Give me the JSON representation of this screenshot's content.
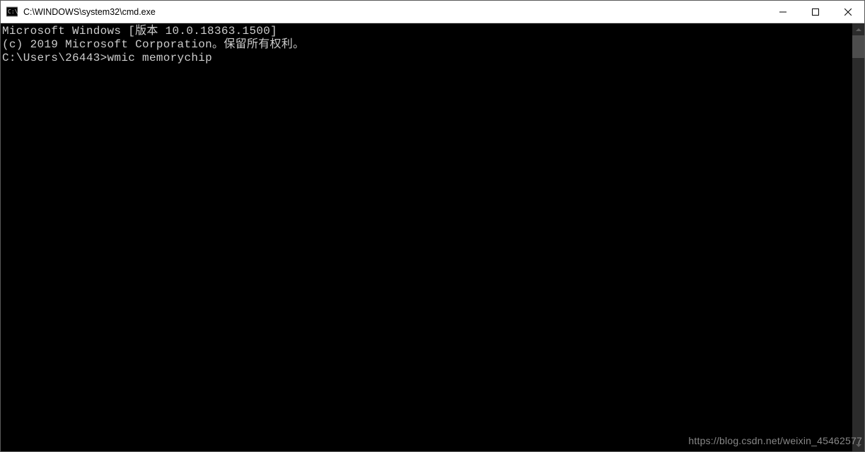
{
  "titlebar": {
    "title": "C:\\WINDOWS\\system32\\cmd.exe"
  },
  "terminal": {
    "line1": "Microsoft Windows [版本 10.0.18363.1500]",
    "line2": "(c) 2019 Microsoft Corporation。保留所有权利。",
    "blank": "",
    "prompt": "C:\\Users\\26443>",
    "command": "wmic memorychip"
  },
  "watermark": "https://blog.csdn.net/weixin_45462577"
}
